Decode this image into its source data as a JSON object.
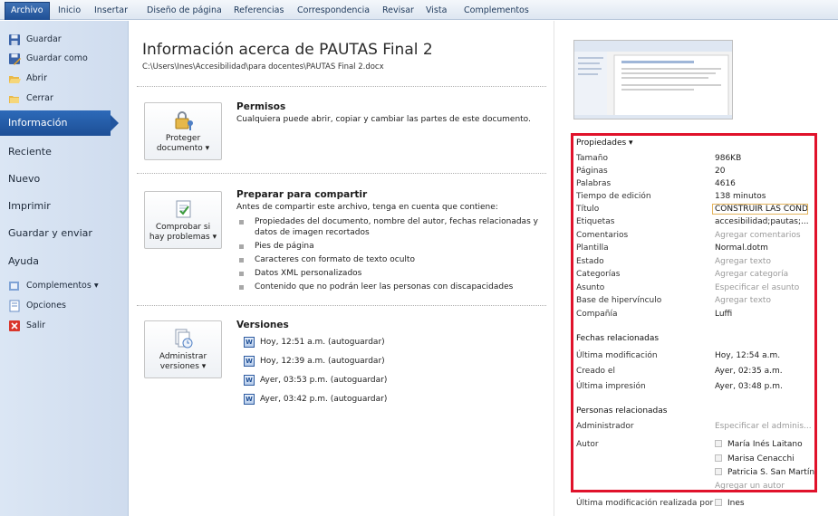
{
  "ribbon": {
    "tabs": [
      "Archivo",
      "Inicio",
      "Insertar",
      "Diseño de página",
      "Referencias",
      "Correspondencia",
      "Revisar",
      "Vista",
      "Complementos"
    ]
  },
  "nav": {
    "guardar": "Guardar",
    "guardar_como": "Guardar como",
    "abrir": "Abrir",
    "cerrar": "Cerrar",
    "informacion": "Información",
    "reciente": "Reciente",
    "nuevo": "Nuevo",
    "imprimir": "Imprimir",
    "guardar_enviar": "Guardar y enviar",
    "ayuda": "Ayuda",
    "complementos": "Complementos ▾",
    "opciones": "Opciones",
    "salir": "Salir"
  },
  "main": {
    "title": "Información acerca de PAUTAS Final 2",
    "path": "C:\\Users\\Ines\\Accesibilidad\\para docentes\\PAUTAS Final 2.docx",
    "permisos": {
      "button_l1": "Proteger",
      "button_l2": "documento ▾",
      "title": "Permisos",
      "text": "Cualquiera puede abrir, copiar y cambiar las partes de este documento."
    },
    "preparar": {
      "button_l1": "Comprobar si",
      "button_l2": "hay problemas ▾",
      "title": "Preparar para compartir",
      "text": "Antes de compartir este archivo, tenga en cuenta que contiene:",
      "bullets": [
        "Propiedades del documento, nombre del autor, fechas relacionadas y datos de imagen recortados",
        "Pies de página",
        "Caracteres con formato de texto oculto",
        "Datos XML personalizados",
        "Contenido que no podrán leer las personas con discapacidades"
      ]
    },
    "versiones": {
      "button_l1": "Administrar",
      "button_l2": "versiones ▾",
      "title": "Versiones",
      "items": [
        "Hoy, 12:51 a.m. (autoguardar)",
        "Hoy, 12:39 a.m. (autoguardar)",
        "Ayer, 03:53 p.m. (autoguardar)",
        "Ayer, 03:42 p.m. (autoguardar)"
      ]
    }
  },
  "props": {
    "header": "Propiedades ▾",
    "rows": [
      {
        "k": "Tamaño",
        "v": "986KB"
      },
      {
        "k": "Páginas",
        "v": "20"
      },
      {
        "k": "Palabras",
        "v": "4616"
      },
      {
        "k": "Tiempo de edición",
        "v": "138 minutos"
      },
      {
        "k": "Título",
        "v": "CONSTRUIR LAS CONDI"
      },
      {
        "k": "Etiquetas",
        "v": "accesibilidad;pautas;..."
      },
      {
        "k": "Comentarios",
        "v": "Agregar comentarios"
      },
      {
        "k": "Plantilla",
        "v": "Normal.dotm"
      },
      {
        "k": "Estado",
        "v": "Agregar texto"
      },
      {
        "k": "Categorías",
        "v": "Agregar categoría"
      },
      {
        "k": "Asunto",
        "v": "Especificar el asunto"
      },
      {
        "k": "Base de hipervínculo",
        "v": "Agregar texto"
      },
      {
        "k": "Compañía",
        "v": "Luffi"
      }
    ],
    "fechas_header": "Fechas relacionadas",
    "fechas": [
      {
        "k": "Última modificación",
        "v": "Hoy, 12:54 a.m."
      },
      {
        "k": "Creado el",
        "v": "Ayer, 02:35 a.m."
      },
      {
        "k": "Última impresión",
        "v": "Ayer, 03:48 p.m."
      }
    ],
    "personas_header": "Personas relacionadas",
    "administrador_k": "Administrador",
    "administrador_v": "Especificar el adminis...",
    "autor_k": "Autor",
    "autores": [
      "María Inés Laitano",
      "Marisa Cenacchi",
      "Patricia S. San Martín"
    ],
    "agregar_autor": "Agregar un autor",
    "ultima_mod_por_k": "Última modificación realizada por",
    "ultima_mod_por_v": "Ines"
  }
}
